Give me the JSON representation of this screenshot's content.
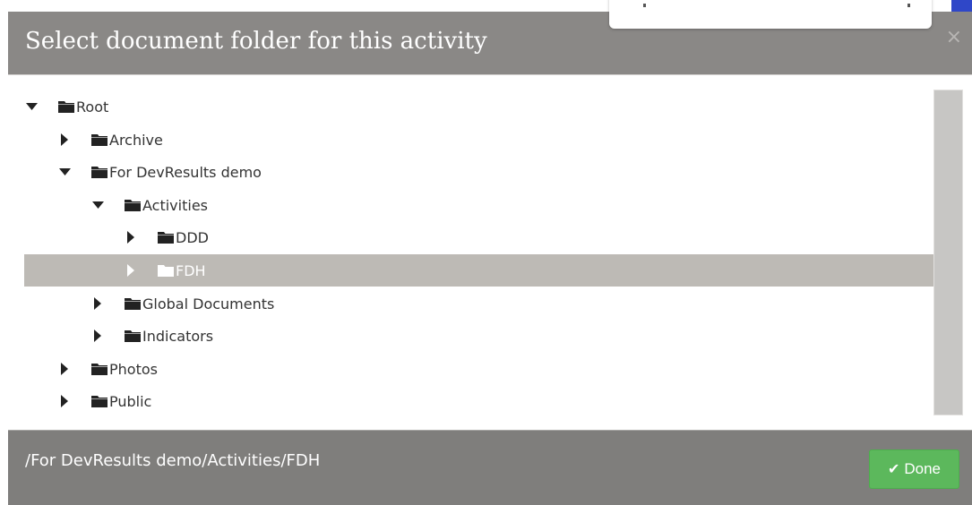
{
  "dialog": {
    "title": "Select document folder for this activity",
    "close_glyph": "×"
  },
  "tree": [
    {
      "id": "root",
      "label": "Root",
      "depth": 0,
      "state": "expanded",
      "selected": false
    },
    {
      "id": "archive",
      "label": "Archive",
      "depth": 1,
      "state": "collapsed",
      "selected": false
    },
    {
      "id": "for-devresults-demo",
      "label": "For DevResults demo",
      "depth": 1,
      "state": "expanded",
      "selected": false
    },
    {
      "id": "activities",
      "label": "Activities",
      "depth": 2,
      "state": "expanded",
      "selected": false
    },
    {
      "id": "ddd",
      "label": "DDD",
      "depth": 3,
      "state": "collapsed",
      "selected": false
    },
    {
      "id": "fdh",
      "label": "FDH",
      "depth": 3,
      "state": "collapsed",
      "selected": true
    },
    {
      "id": "global-documents",
      "label": "Global Documents",
      "depth": 2,
      "state": "collapsed",
      "selected": false
    },
    {
      "id": "indicators",
      "label": "Indicators",
      "depth": 2,
      "state": "collapsed",
      "selected": false
    },
    {
      "id": "photos",
      "label": "Photos",
      "depth": 1,
      "state": "collapsed",
      "selected": false
    },
    {
      "id": "public",
      "label": "Public",
      "depth": 1,
      "state": "collapsed",
      "selected": false
    }
  ],
  "footer": {
    "selected_path": "/For DevResults demo/Activities/FDH",
    "done_label": "Done",
    "done_icon": "check-icon"
  },
  "colors": {
    "header_bg": "#8a8886",
    "footer_bg": "#7f7e7c",
    "selected_row": "#bdbab5",
    "done_button": "#5cb85c",
    "badge": "#2f47c8"
  }
}
